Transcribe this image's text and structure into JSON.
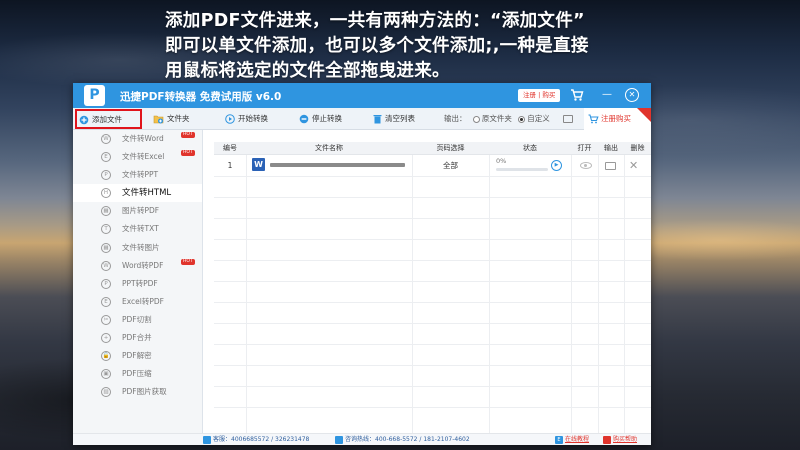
{
  "caption": {
    "line1": "添加PDF文件进来，一共有两种方法的：“添加文件”",
    "line2": "即可以单文件添加，也可以多个文件添加;,一种是直接",
    "line3": "用鼠标将选定的文件全部拖曳进来。"
  },
  "app": {
    "logo_letter": "P",
    "title": "迅捷PDF转换器 免费试用版 v6.0",
    "reg_buy_link": "注册 | 购买",
    "accent_color": "#2f95e0",
    "highlight_color": "#e0141c"
  },
  "toolbar": {
    "add_file": "添加文件",
    "add_folder": "文件夹",
    "start": "开始转换",
    "stop": "停止转换",
    "clear": "清空列表",
    "output_label": "输出：",
    "option_original": "原文件夹",
    "option_custom": "自定义",
    "selected_option": "自定义",
    "register_purchase": "注册购买"
  },
  "sidebar": {
    "items": [
      {
        "label": "文件转Word",
        "icon": "W",
        "hot": "HOT"
      },
      {
        "label": "文件转Excel",
        "icon": "E",
        "hot": "HOT"
      },
      {
        "label": "文件转PPT",
        "icon": "P",
        "hot": ""
      },
      {
        "label": "文件转HTML",
        "icon": "H",
        "hot": "",
        "active": true
      },
      {
        "label": "图片转PDF",
        "icon": "▦",
        "hot": ""
      },
      {
        "label": "文件转TXT",
        "icon": "T",
        "hot": ""
      },
      {
        "label": "文件转图片",
        "icon": "▦",
        "hot": ""
      },
      {
        "label": "Word转PDF",
        "icon": "W",
        "hot": "HOT"
      },
      {
        "label": "PPT转PDF",
        "icon": "P",
        "hot": ""
      },
      {
        "label": "Excel转PDF",
        "icon": "E",
        "hot": ""
      },
      {
        "label": "PDF切割",
        "icon": "✂",
        "hot": ""
      },
      {
        "label": "PDF合并",
        "icon": "+",
        "hot": ""
      },
      {
        "label": "PDF解密",
        "icon": "🔓",
        "hot": ""
      },
      {
        "label": "PDF压缩",
        "icon": "▣",
        "hot": ""
      },
      {
        "label": "PDF图片获取",
        "icon": "▨",
        "hot": ""
      }
    ]
  },
  "table": {
    "headers": [
      "编号",
      "文件名称",
      "页码选择",
      "状态",
      "打开",
      "输出",
      "删除"
    ],
    "rows": [
      {
        "index": "1",
        "file_icon": "W",
        "pages": "全部",
        "progress_label": "0%",
        "progress": 0
      }
    ]
  },
  "statusbar": {
    "qq": "客服：4006685572 / 326231478",
    "phone": "咨询热线：400-668-5572 / 181-2107-4602",
    "tutorial": "在线教程",
    "support": "购买帮助"
  }
}
